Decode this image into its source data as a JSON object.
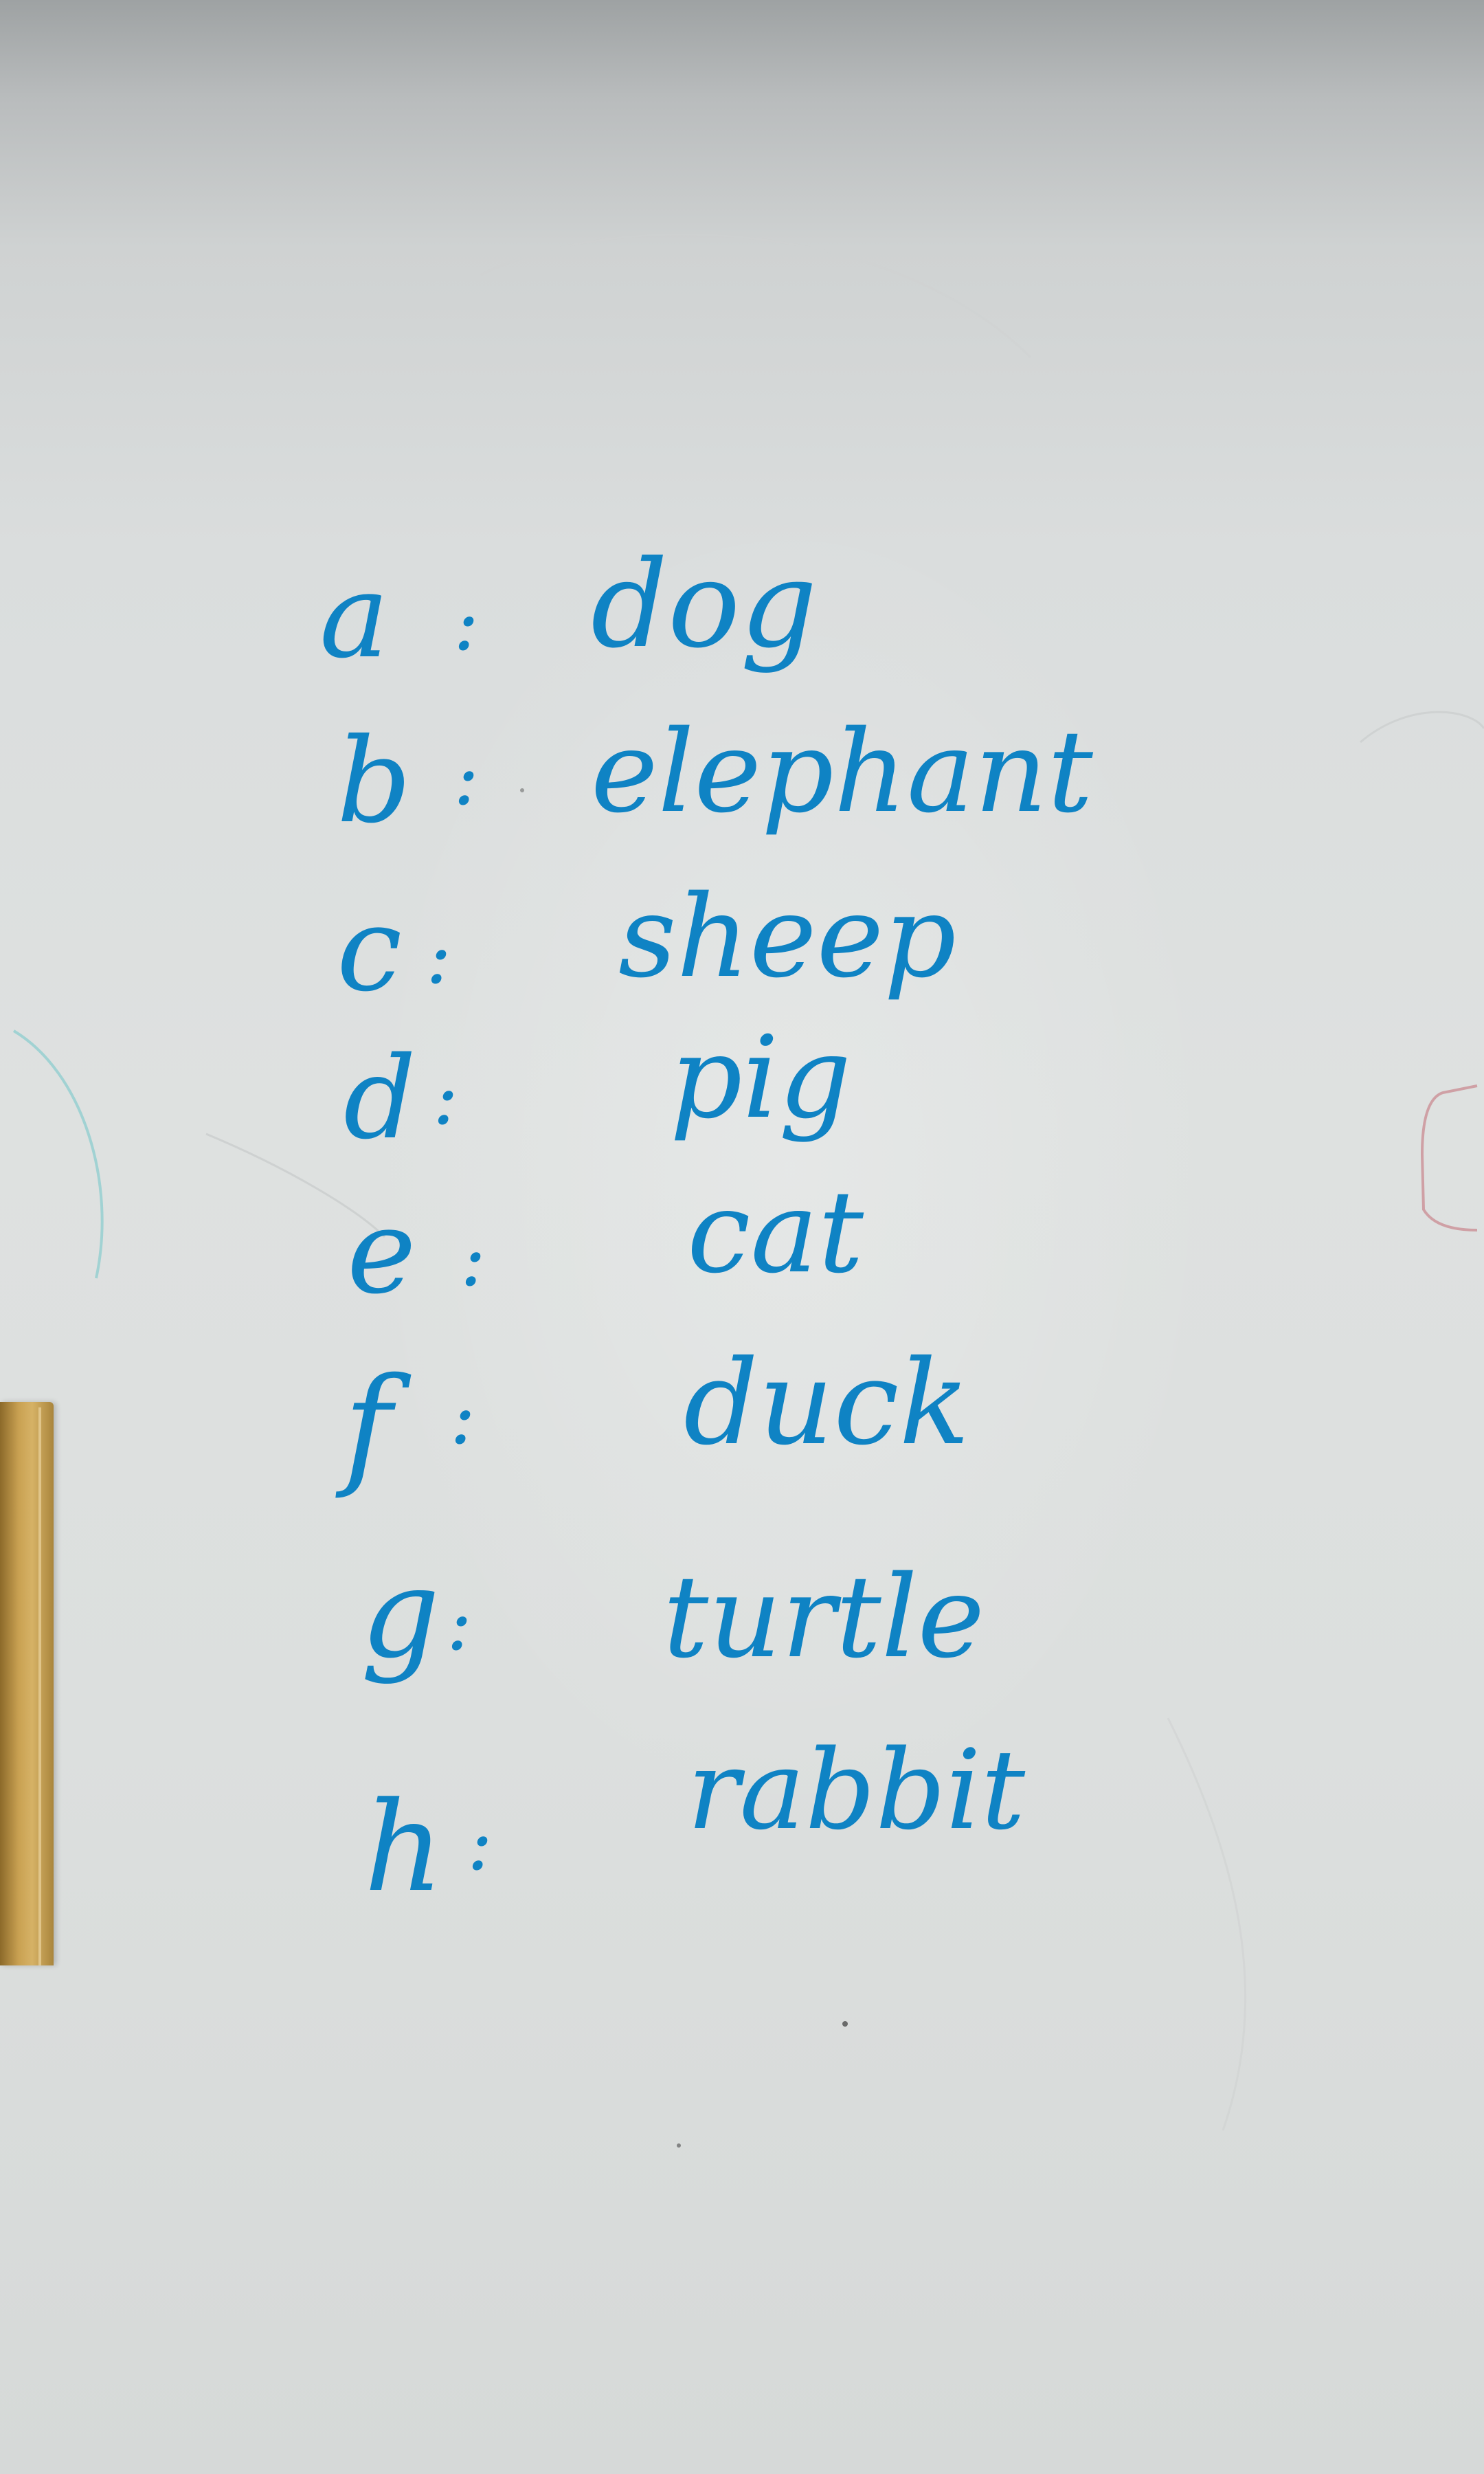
{
  "whiteboard": {
    "ink_color": "#0f83c4",
    "entries": [
      {
        "letter": "a",
        "separator": ":",
        "word": "dog"
      },
      {
        "letter": "b",
        "separator": ":",
        "word": "elephant"
      },
      {
        "letter": "c",
        "separator": ":",
        "word": "sheep"
      },
      {
        "letter": "d",
        "separator": ":",
        "word": "pig"
      },
      {
        "letter": "e",
        "separator": ":",
        "word": "cat"
      },
      {
        "letter": "f",
        "separator": ":",
        "word": "duck"
      },
      {
        "letter": "g",
        "separator": ":",
        "word": "turtle"
      },
      {
        "letter": "h",
        "separator": ":",
        "word": "rabbit"
      }
    ]
  }
}
